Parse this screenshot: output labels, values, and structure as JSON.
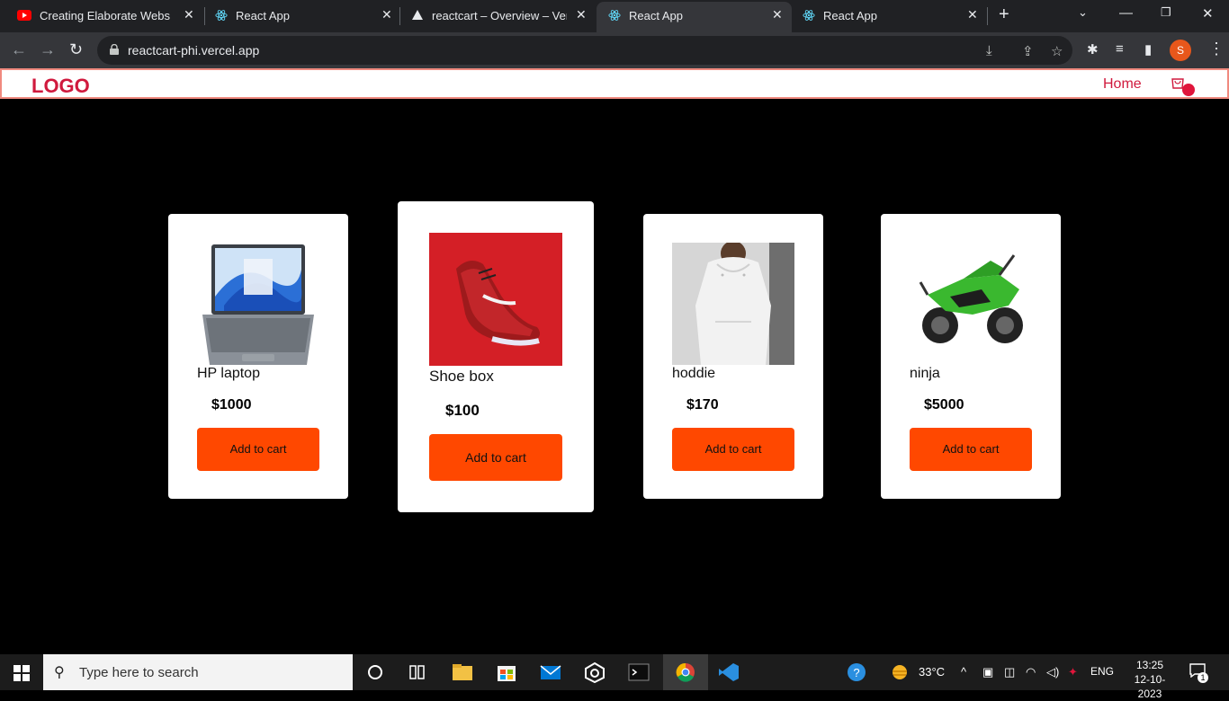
{
  "browser": {
    "tabs": [
      {
        "label": "Creating Elaborate Website",
        "icon": "youtube-icon"
      },
      {
        "label": "React App",
        "icon": "react-icon"
      },
      {
        "label": "reactcart – Overview – Vercel",
        "icon": "vercel-icon"
      },
      {
        "label": "React App",
        "icon": "react-icon",
        "active": true
      },
      {
        "label": "React App",
        "icon": "react-icon"
      }
    ],
    "url": "reactcart-phi.vercel.app",
    "profile_initial": "S"
  },
  "site": {
    "logo": "LOGO",
    "nav": {
      "home": "Home"
    },
    "colors": {
      "accent": "#d0193d",
      "button": "#ff4800"
    }
  },
  "products": [
    {
      "name": "HP laptop",
      "price": "$1000",
      "button": "Add to cart"
    },
    {
      "name": "Shoe box",
      "price": "$100",
      "button": "Add to cart"
    },
    {
      "name": "hoddie",
      "price": "$170",
      "button": "Add to cart"
    },
    {
      "name": "ninja",
      "price": "$5000",
      "button": "Add to cart"
    }
  ],
  "taskbar": {
    "search_placeholder": "Type here to search",
    "weather": "33°C",
    "language": "ENG",
    "time": "13:25",
    "date": "12-10-2023",
    "notification_count": "1"
  }
}
